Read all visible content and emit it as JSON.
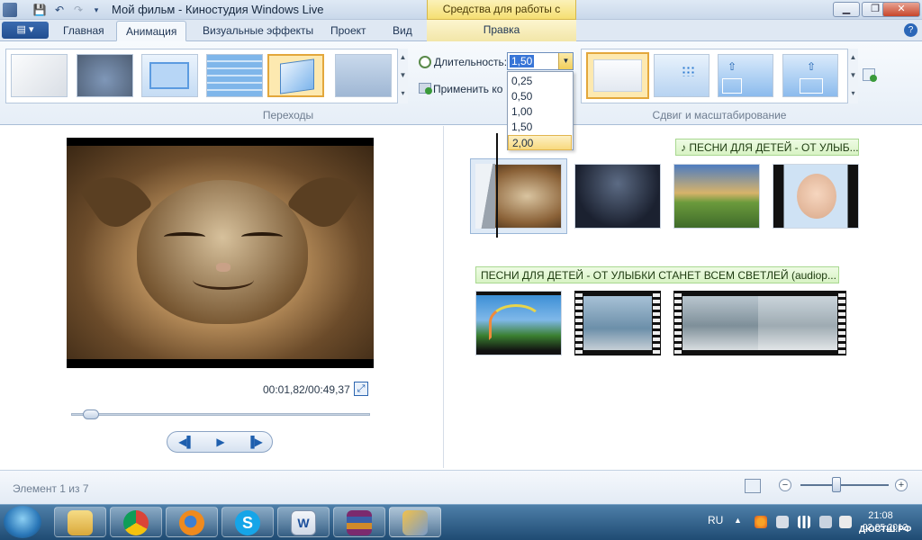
{
  "titlebar": {
    "title": "Мой фильм - Киностудия Windows Live",
    "context_tab_group": "Средства для работы с видео",
    "buttons": {
      "minimize": "▁",
      "maximize": "❐",
      "close": "✕"
    }
  },
  "tabs": [
    "Главная",
    "Анимация",
    "Визуальные эффекты",
    "Проект",
    "Вид"
  ],
  "active_tab": "Анимация",
  "context_tab": "Правка",
  "ribbon": {
    "transitions_group_label": "Переходы",
    "duration_label": "Длительность:",
    "duration_value": "1,50",
    "apply_to_all_label": "Применить ко",
    "duration_options": [
      "0,25",
      "0,50",
      "1,00",
      "1,50",
      "2,00"
    ],
    "duration_highlighted": "2,00",
    "pan_zoom_group_label": "Сдвиг и масштабирование"
  },
  "preview": {
    "time": "00:01,82/00:49,37",
    "seek_fraction": 0.04
  },
  "storyboard": {
    "music_track_1": "♪ ПЕСНИ ДЛЯ ДЕТЕЙ - ОТ УЛЫБ...",
    "music_track_2": "ПЕСНИ ДЛЯ ДЕТЕЙ - ОТ УЛЫБКИ СТАНЕТ ВСЕМ СВЕТЛЕЙ  (audiop..."
  },
  "status": {
    "element_text": "Элемент 1 из 7"
  },
  "taskbar": {
    "language": "RU",
    "time": "21:08",
    "date": "02.05.2012",
    "watermark": "ДЮСТШ.РФ"
  },
  "colors": {
    "ribbon_bg": "#e6eef7",
    "accent_blue": "#2b67b8",
    "highlight_gold": "#f5df72",
    "music_green": "#d8f3c4"
  }
}
